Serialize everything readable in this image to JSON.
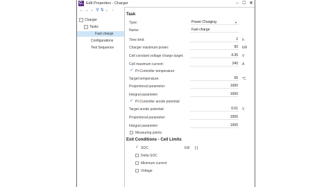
{
  "window": {
    "logo_letter": "C.",
    "title": "Edit Properties - Charger",
    "min_label": "–",
    "max_label": "☐",
    "close_label": "✕"
  },
  "toolbar": {
    "back_icon": "←",
    "forward_icon": "→",
    "dropdown_icon": "⌄",
    "search_icon": "⚲",
    "sort_icon": "⇅",
    "sort_dropdown_icon": "⌄",
    "download_icon": "↓"
  },
  "tree": {
    "root_expander": "−",
    "root": "Charger",
    "tasks_expander": "−",
    "tasks": "Tasks",
    "fast_charge": "Fast charge",
    "configurations": "Configurations",
    "test_sequence": "Test Sequence"
  },
  "task": {
    "section_title": "Task",
    "type_label": "Type:",
    "type_value": "Power Charging",
    "name_label": "Name:",
    "name_value": "Fast charge",
    "time_limit_label": "Time limit:",
    "time_limit_value": "2",
    "time_limit_unit": "h",
    "charger_max_power_label": "Charger maximum power:",
    "charger_max_power_value": "50",
    "charger_max_power_unit": "kW",
    "cc_voltage_target_label": "Cell constant voltage charge target:",
    "cc_voltage_target_value": "4.35",
    "cc_voltage_target_unit": "V",
    "cell_max_current_label": "Cell maximum current:",
    "cell_max_current_value": "240",
    "cell_max_current_unit": "A",
    "pi_temp_check": "✓",
    "pi_temp_label": "PI-Controller temperature",
    "target_temp_label": "Target temperature:",
    "target_temp_value": "55",
    "target_temp_unit": "°C",
    "prop_param1_label": "Proportional parameter:",
    "prop_param1_value": "1000",
    "int_param1_label": "Integral parameter:",
    "int_param1_value": "1000",
    "pi_anode_check": "✓",
    "pi_anode_label": "PI-Controller anode potential",
    "target_anode_label": "Target anode potential:",
    "target_anode_value": "0.01",
    "target_anode_unit": "V",
    "prop_param2_label": "Proportional parameter:",
    "prop_param2_value": "1000",
    "int_param2_label": "Integral parameter:",
    "int_param2_value": "1000",
    "measuring_points_label": "Measuring points"
  },
  "exit": {
    "section_title": "Exit Conditions - Cell Limits",
    "soc_check": "✓",
    "soc_label": "SOC",
    "soc_value": "0.8",
    "soc_unit": "[-]",
    "delta_soc_label": "Delta SOC",
    "min_current_label": "Minimum current",
    "voltage_label": "Voltage"
  }
}
